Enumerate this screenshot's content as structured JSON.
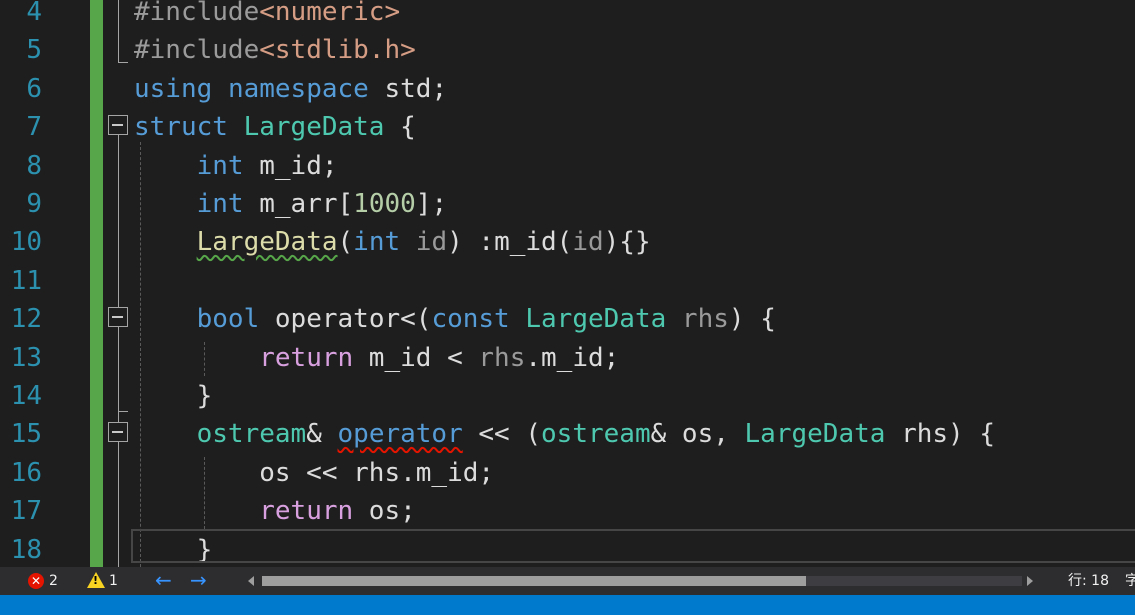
{
  "editor": {
    "lines": [
      {
        "num": "4",
        "tokens": [
          {
            "t": "#include",
            "c": "pp"
          },
          {
            "t": "<numeric>",
            "c": "str"
          }
        ]
      },
      {
        "num": "5",
        "tokens": [
          {
            "t": "#include",
            "c": "pp"
          },
          {
            "t": "<stdlib.h>",
            "c": "str"
          }
        ]
      },
      {
        "num": "6",
        "tokens": [
          {
            "t": "using",
            "c": "kw"
          },
          {
            "t": " ",
            "c": "plain"
          },
          {
            "t": "namespace",
            "c": "kw"
          },
          {
            "t": " std;",
            "c": "plain"
          }
        ]
      },
      {
        "num": "7",
        "tokens": [
          {
            "t": "struct",
            "c": "kw"
          },
          {
            "t": " ",
            "c": "plain"
          },
          {
            "t": "LargeData",
            "c": "type"
          },
          {
            "t": " {",
            "c": "plain"
          }
        ]
      },
      {
        "num": "8",
        "tokens": [
          {
            "t": "    ",
            "c": "plain"
          },
          {
            "t": "int",
            "c": "kw"
          },
          {
            "t": " m_id;",
            "c": "plain"
          }
        ]
      },
      {
        "num": "9",
        "tokens": [
          {
            "t": "    ",
            "c": "plain"
          },
          {
            "t": "int",
            "c": "kw"
          },
          {
            "t": " m_arr[",
            "c": "plain"
          },
          {
            "t": "1000",
            "c": "num"
          },
          {
            "t": "];",
            "c": "plain"
          }
        ]
      },
      {
        "num": "10",
        "tokens": [
          {
            "t": "    ",
            "c": "plain"
          },
          {
            "t": "LargeData",
            "c": "fn",
            "squiggle": "green"
          },
          {
            "t": "(",
            "c": "plain"
          },
          {
            "t": "int",
            "c": "kw"
          },
          {
            "t": " ",
            "c": "plain"
          },
          {
            "t": "id",
            "c": "param"
          },
          {
            "t": ") :m_id(",
            "c": "plain"
          },
          {
            "t": "id",
            "c": "param"
          },
          {
            "t": "){}",
            "c": "plain"
          }
        ]
      },
      {
        "num": "11",
        "tokens": []
      },
      {
        "num": "12",
        "tokens": [
          {
            "t": "    ",
            "c": "plain"
          },
          {
            "t": "bool",
            "c": "kw"
          },
          {
            "t": " operator<(",
            "c": "plain"
          },
          {
            "t": "const",
            "c": "kw"
          },
          {
            "t": " ",
            "c": "plain"
          },
          {
            "t": "LargeData",
            "c": "type"
          },
          {
            "t": " ",
            "c": "plain"
          },
          {
            "t": "rhs",
            "c": "param"
          },
          {
            "t": ") {",
            "c": "plain"
          }
        ]
      },
      {
        "num": "13",
        "tokens": [
          {
            "t": "        ",
            "c": "plain"
          },
          {
            "t": "return",
            "c": "kw2"
          },
          {
            "t": " m_id < ",
            "c": "plain"
          },
          {
            "t": "rhs",
            "c": "param"
          },
          {
            "t": ".m_id;",
            "c": "plain"
          }
        ]
      },
      {
        "num": "14",
        "tokens": [
          {
            "t": "    }",
            "c": "plain"
          }
        ]
      },
      {
        "num": "15",
        "tokens": [
          {
            "t": "    ",
            "c": "plain"
          },
          {
            "t": "ostream",
            "c": "type"
          },
          {
            "t": "& ",
            "c": "plain"
          },
          {
            "t": "operator",
            "c": "kw",
            "squiggle": "red"
          },
          {
            "t": " << (",
            "c": "plain"
          },
          {
            "t": "ostream",
            "c": "type"
          },
          {
            "t": "& os, ",
            "c": "plain"
          },
          {
            "t": "LargeData",
            "c": "type"
          },
          {
            "t": " rhs) {",
            "c": "plain"
          }
        ]
      },
      {
        "num": "16",
        "tokens": [
          {
            "t": "        os << rhs.m_id;",
            "c": "plain"
          }
        ]
      },
      {
        "num": "17",
        "tokens": [
          {
            "t": "        ",
            "c": "plain"
          },
          {
            "t": "return",
            "c": "kw2"
          },
          {
            "t": " os;",
            "c": "plain"
          }
        ]
      },
      {
        "num": "18",
        "tokens": [
          {
            "t": "    }",
            "c": "plain"
          }
        ]
      }
    ]
  },
  "statusbar": {
    "error_count": "2",
    "warning_count": "1",
    "back_arrow": "←",
    "forward_arrow": "→",
    "line_label": "行: 18",
    "trailing_text": "字"
  },
  "colors": {
    "background": "#1e1e1e",
    "line_number": "#2b91af",
    "keyword": "#569cd6",
    "type": "#4ec9b0",
    "change_bar": "#57a64a",
    "status_bar": "#2d2d30",
    "accent_blue": "#007acc"
  }
}
